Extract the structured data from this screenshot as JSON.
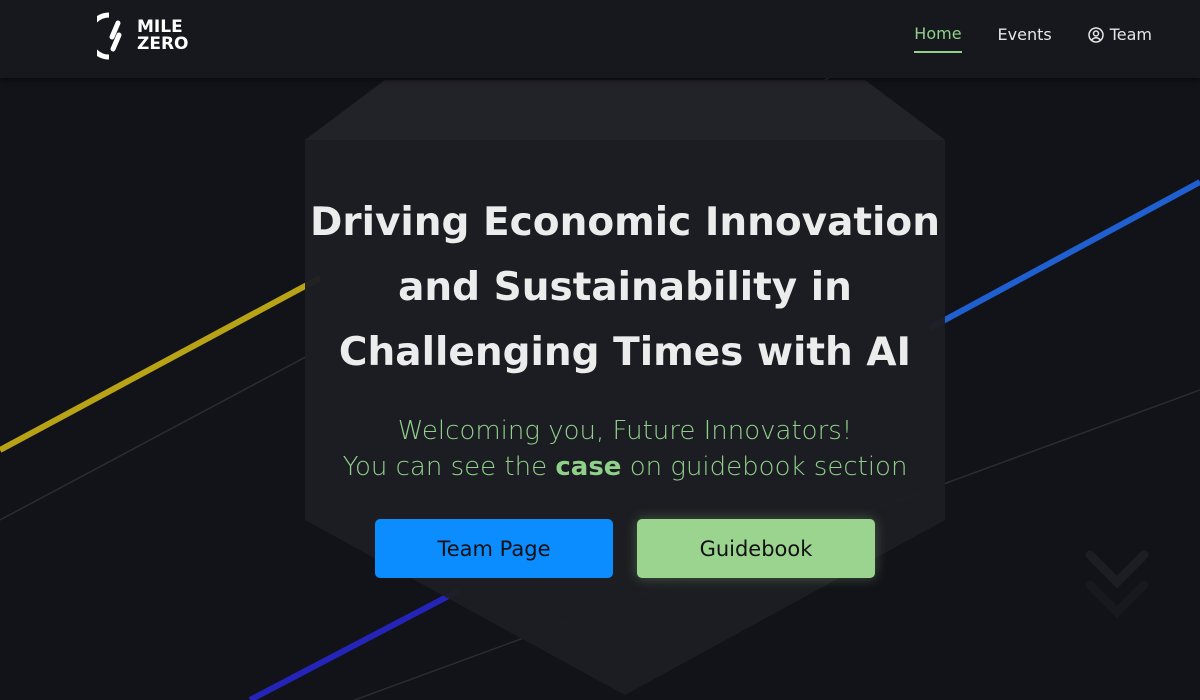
{
  "brand": {
    "line1": "MILE",
    "line2": "ZERO"
  },
  "nav": [
    {
      "label": "Home",
      "active": true
    },
    {
      "label": "Events"
    },
    {
      "label": "Team",
      "icon": "user-circle-icon"
    }
  ],
  "hero": {
    "title_lines": [
      "Driving Economic Innovation",
      "and Sustainability in",
      "Challenging Times with AI"
    ],
    "subtitle_line1": "Welcoming you, Future Innovators!",
    "subtitle_pre": "You can see the ",
    "subtitle_bold": "case",
    "subtitle_post": " on guidebook section"
  },
  "buttons": {
    "team_page": "Team Page",
    "guidebook": "Guidebook"
  },
  "colors": {
    "accent_green": "#8fd18a",
    "button_blue": "#0b8cff",
    "line_yellow": "#b8a316",
    "line_blue": "#1f5fd0"
  }
}
